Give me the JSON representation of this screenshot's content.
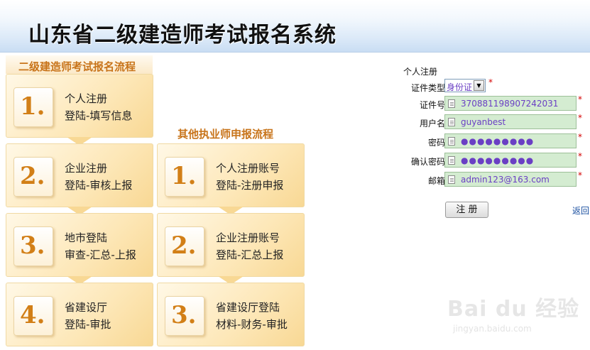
{
  "header": {
    "title": "山东省二级建造师考试报名系统"
  },
  "flow_main": {
    "title": "二级建造师考试报名流程",
    "steps": [
      {
        "number": "1.",
        "line1": "个人注册",
        "line2": "登陆-填写信息"
      },
      {
        "number": "2.",
        "line1": "企业注册",
        "line2": "登陆-审核上报"
      },
      {
        "number": "3.",
        "line1": "地市登陆",
        "line2": "审查-汇总-上报"
      },
      {
        "number": "4.",
        "line1": "省建设厅",
        "line2": "登陆-审批"
      }
    ]
  },
  "flow_other": {
    "title": "其他执业师申报流程",
    "steps": [
      {
        "number": "1.",
        "line1": "个人注册账号",
        "line2": "登陆-注册申报"
      },
      {
        "number": "2.",
        "line1": "企业注册账号",
        "line2": "登陆-汇总上报"
      },
      {
        "number": "3.",
        "line1": "省建设厅登陆",
        "line2": "材料-财务-审批"
      }
    ]
  },
  "form": {
    "heading": "个人注册",
    "required_mark": "*",
    "id_type": {
      "label": "证件类型:",
      "value": "身份证",
      "arrow": "▼"
    },
    "id_number": {
      "label": "证件号:",
      "value": "370881198907242031"
    },
    "username": {
      "label": "用户名:",
      "value": "guyanbest"
    },
    "password": {
      "label": "密码:",
      "value": "●●●●●●●●●"
    },
    "confirm_password": {
      "label": "确认密码:",
      "value": "●●●●●●●●●"
    },
    "email": {
      "label": "邮箱:",
      "value": "admin123@163.com"
    },
    "register_button": "注 册",
    "back_link": "返回"
  },
  "watermark": {
    "text": "Bai du 经验",
    "url": "jingyan.baidu.com"
  },
  "colors": {
    "accent_orange": "#d27f17",
    "field_green": "#d4ecd1",
    "field_text": "#6a3fc4",
    "required_red": "#d40000"
  }
}
